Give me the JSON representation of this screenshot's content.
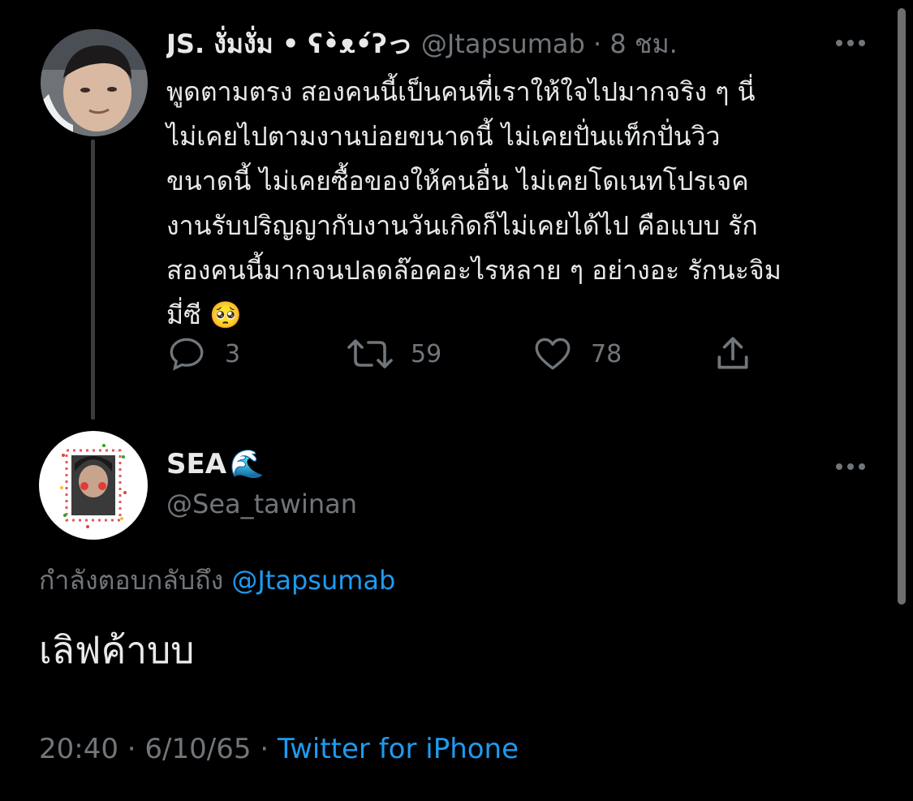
{
  "tweet": {
    "display_name": "JS. งั่มงั่ม • ʕ•̀ᴥ•́ʔっ",
    "handle": "@Jtapsumab",
    "separator": "·",
    "time": "8 ชม.",
    "text": "พูดตามตรง สองคนนี้เป็นคนที่เราให้ใจไปมากจริง ๆ นี่\nไม่เคยไปตามงานบ่อยขนาดนี้ ไม่เคยปั่นแท็กปั่นวิว\nขนาดนี้ ไม่เคยซื้อของให้คนอื่น ไม่เคยโดเนทโปรเจค\nงานรับปริญญากับงานวันเกิดก็ไม่เคยได้ไป คือแบบ รัก\nสองคนนี้มากจนปลดล๊อคอะไรหลาย ๆ อย่างอะ รักนะจิม\nมี่ซี 🥺",
    "actions": {
      "reply_count": "3",
      "retweet_count": "59",
      "like_count": "78"
    }
  },
  "reply": {
    "display_name": "SEA",
    "name_emoji": "🌊",
    "handle": "@Sea_tawinan",
    "replying_to_label": "กำลังตอบกลับถึง",
    "replying_to_handle": "@Jtapsumab",
    "text": "เลิฟค้าบบ",
    "timestamp": "20:40",
    "date": "6/10/65",
    "source": "Twitter for iPhone"
  },
  "colors": {
    "background": "#000000",
    "text": "#e7e9ea",
    "muted": "#71767b",
    "link": "#1d9bf0"
  }
}
